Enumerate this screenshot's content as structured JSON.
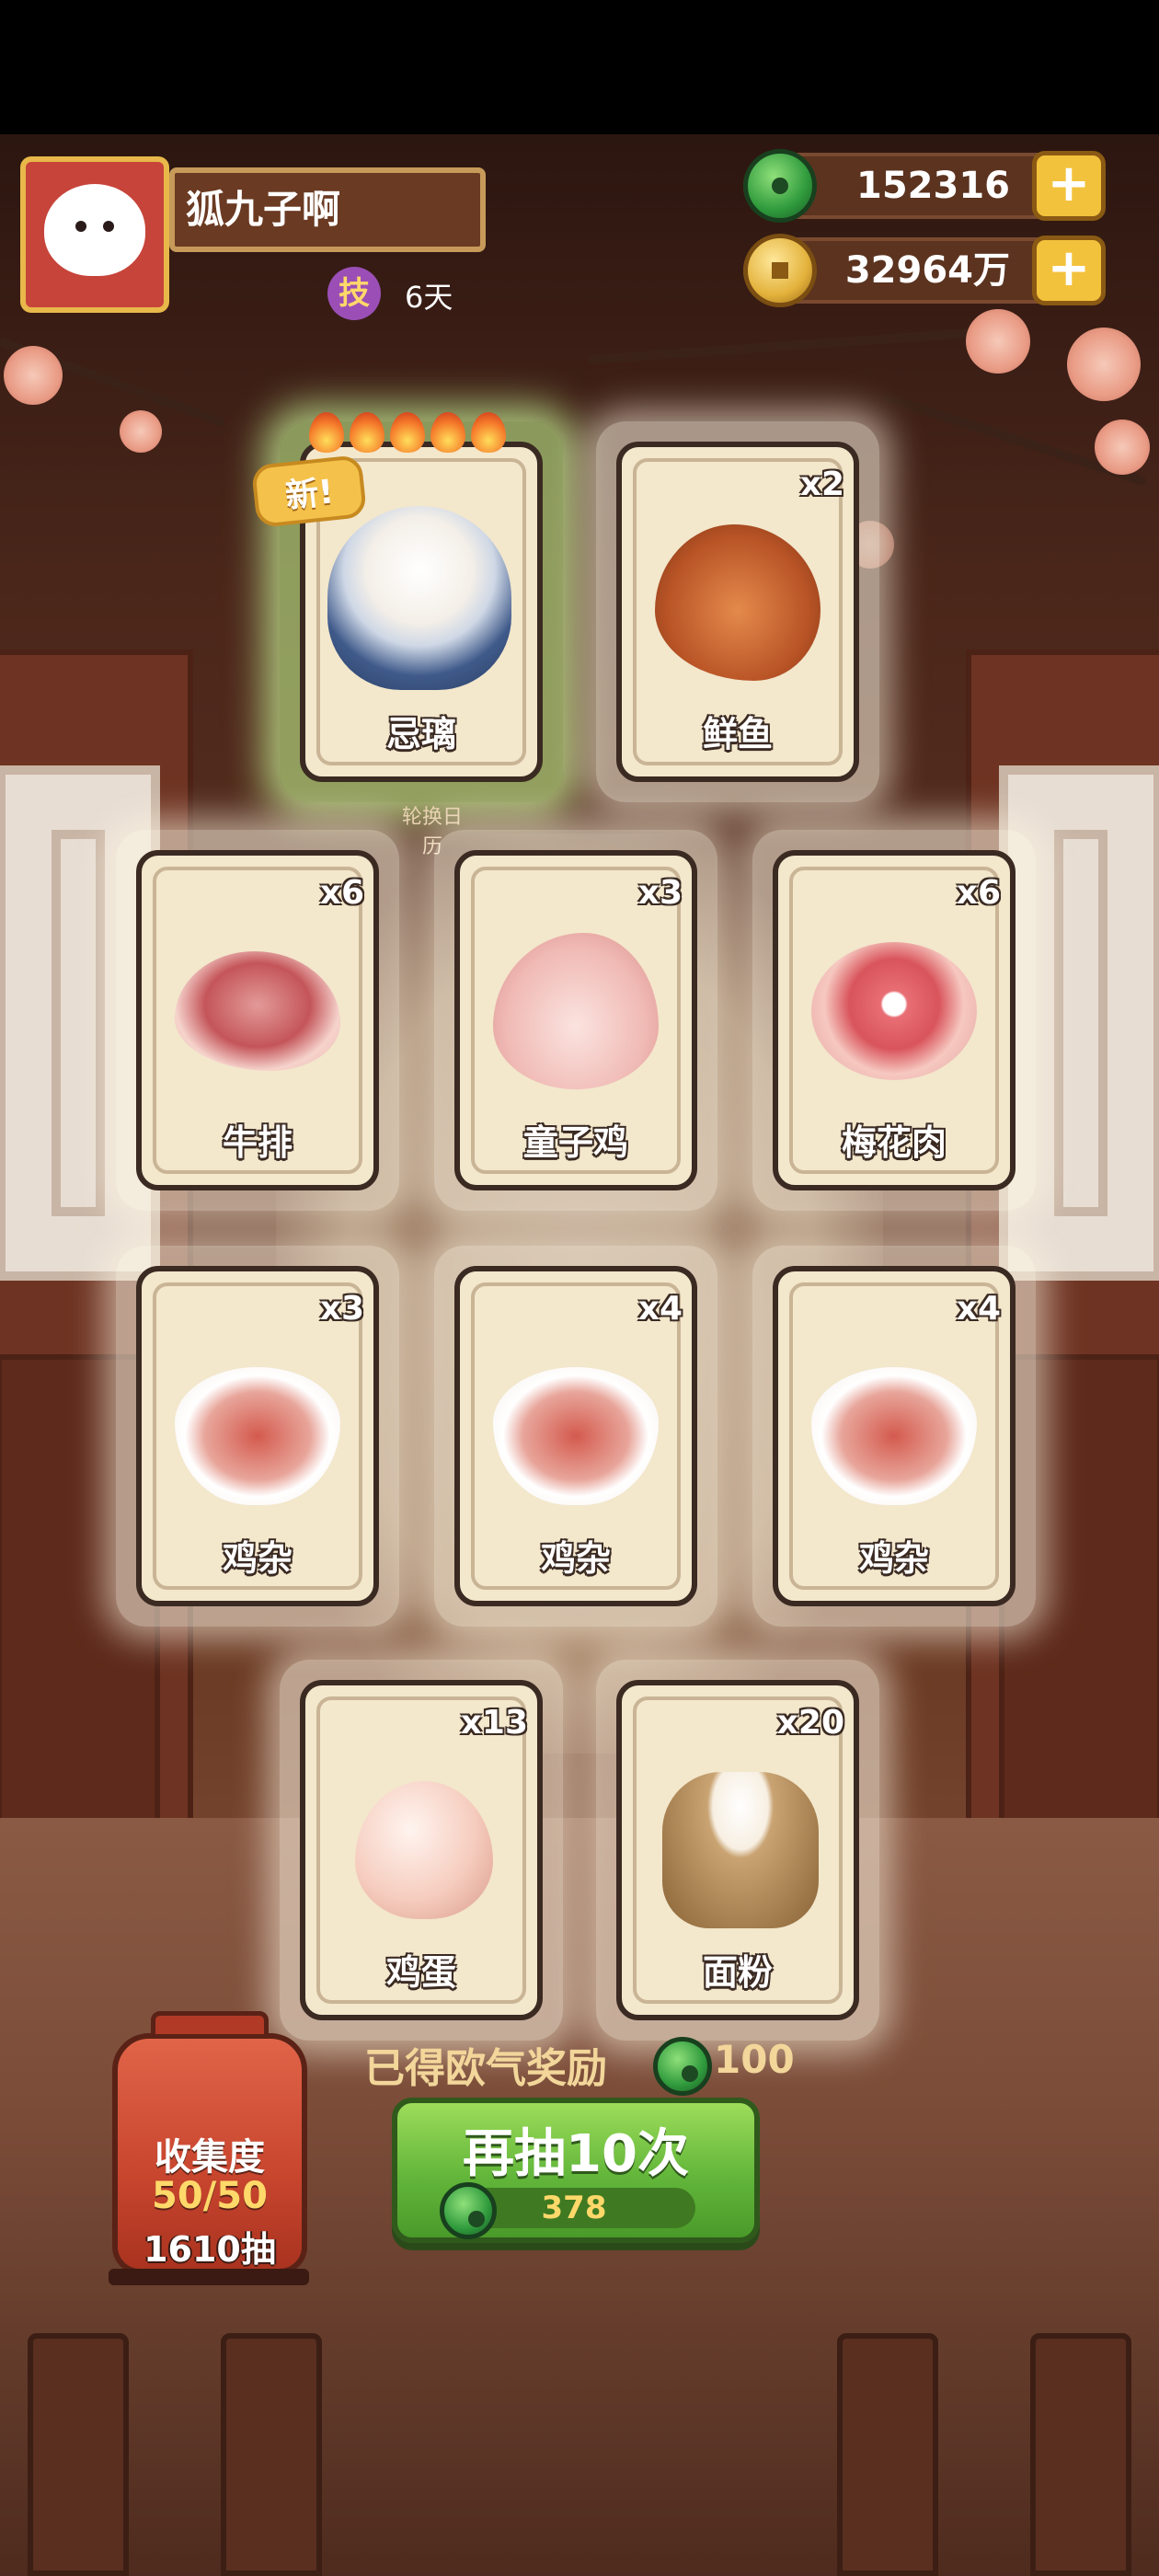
{
  "player": {
    "name": "狐九子啊",
    "days": "6天",
    "skill_badge": "技"
  },
  "currency": {
    "jade": "152316",
    "gold": "32964万",
    "add": "+"
  },
  "cards": [
    {
      "name": "忌璃",
      "count": "",
      "badge": "新!"
    },
    {
      "name": "鲜鱼",
      "count": "x2"
    },
    {
      "name": "牛排",
      "count": "x6"
    },
    {
      "name": "童子鸡",
      "count": "x3"
    },
    {
      "name": "梅花肉",
      "count": "x6"
    },
    {
      "name": "鸡杂",
      "count": "x3"
    },
    {
      "name": "鸡杂",
      "count": "x4"
    },
    {
      "name": "鸡杂",
      "count": "x4"
    },
    {
      "name": "鸡蛋",
      "count": "x13"
    },
    {
      "name": "面粉",
      "count": "x20"
    }
  ],
  "caption": "轮换日历",
  "reward": {
    "label": "已得欧气奖励",
    "value": "100"
  },
  "draw_button": {
    "label": "再抽10次",
    "cost": "378"
  },
  "collection": {
    "title": "收集度",
    "progress": "50/50",
    "draws": "1610抽"
  },
  "colors": {
    "card_bg": "#f3e7cc",
    "draw_button": "#62b63a",
    "gold_plus": "#f3c23c",
    "lantern": "#c8452e"
  }
}
